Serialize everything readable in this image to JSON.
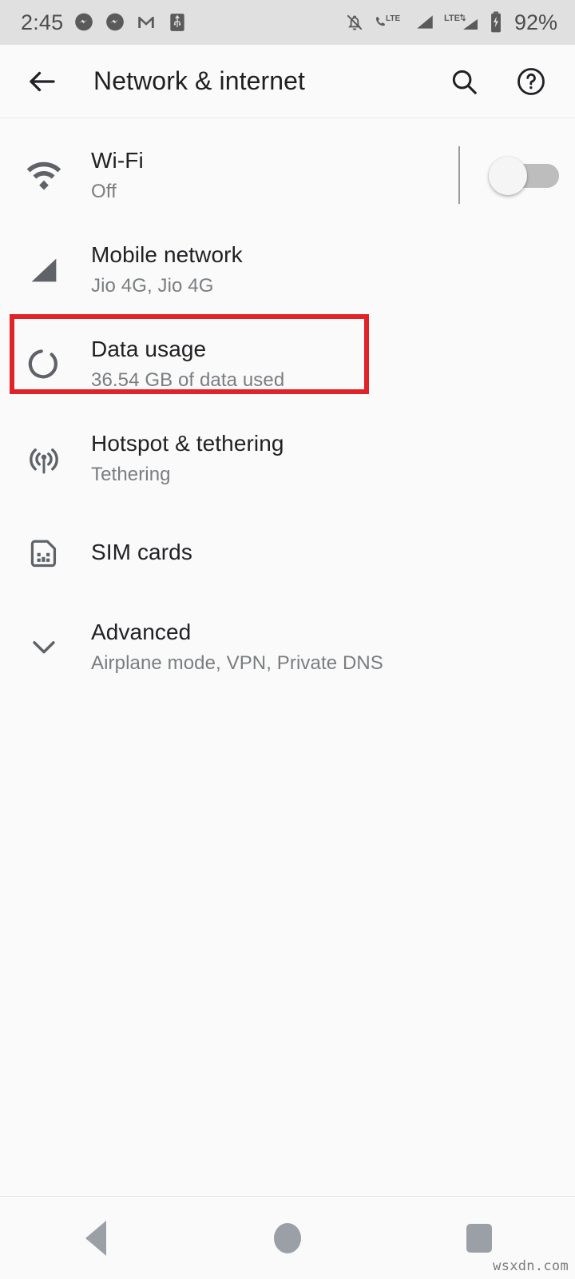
{
  "status_bar": {
    "time": "2:45",
    "battery_percent": "92%",
    "left_icons": [
      "messenger-icon",
      "messenger-icon",
      "gmail-icon",
      "usb-icon"
    ],
    "right_icons": [
      "notifications-off-icon",
      "volte-icon",
      "signal-bars-icon",
      "lte-data-icon",
      "signal-bars-2-icon",
      "battery-charging-icon"
    ],
    "volte_label": "LTE",
    "lte_label": "LTE",
    "background_color": "#e0e0e0"
  },
  "app_bar": {
    "title": "Network & internet",
    "back_icon": "back-arrow-icon",
    "search_icon": "search-icon",
    "help_icon": "help-circle-icon"
  },
  "settings": {
    "items": [
      {
        "id": "wifi",
        "icon": "wifi-icon",
        "title": "Wi-Fi",
        "subtitle": "Off",
        "has_switch": true,
        "switch_on": false
      },
      {
        "id": "mobile-network",
        "icon": "signal-triangle-icon",
        "title": "Mobile network",
        "subtitle": "Jio 4G, Jio 4G",
        "has_switch": false
      },
      {
        "id": "data-usage",
        "icon": "data-usage-ring-icon",
        "title": "Data usage",
        "subtitle": "36.54 GB of data used",
        "has_switch": false,
        "highlighted": true
      },
      {
        "id": "hotspot-tethering",
        "icon": "hotspot-icon",
        "title": "Hotspot & tethering",
        "subtitle": "Tethering",
        "has_switch": false
      },
      {
        "id": "sim-cards",
        "icon": "sim-card-icon",
        "title": "SIM cards",
        "subtitle": "",
        "has_switch": false
      },
      {
        "id": "advanced",
        "icon": "chevron-down-icon",
        "title": "Advanced",
        "subtitle": "Airplane mode, VPN, Private DNS",
        "has_switch": false
      }
    ]
  },
  "annotation": {
    "target": "data-usage",
    "color": "#e02329"
  },
  "nav_bar": {
    "back_label": "Back",
    "home_label": "Home",
    "recents_label": "Recents"
  },
  "watermark": {
    "text": "wsxdn.com"
  }
}
